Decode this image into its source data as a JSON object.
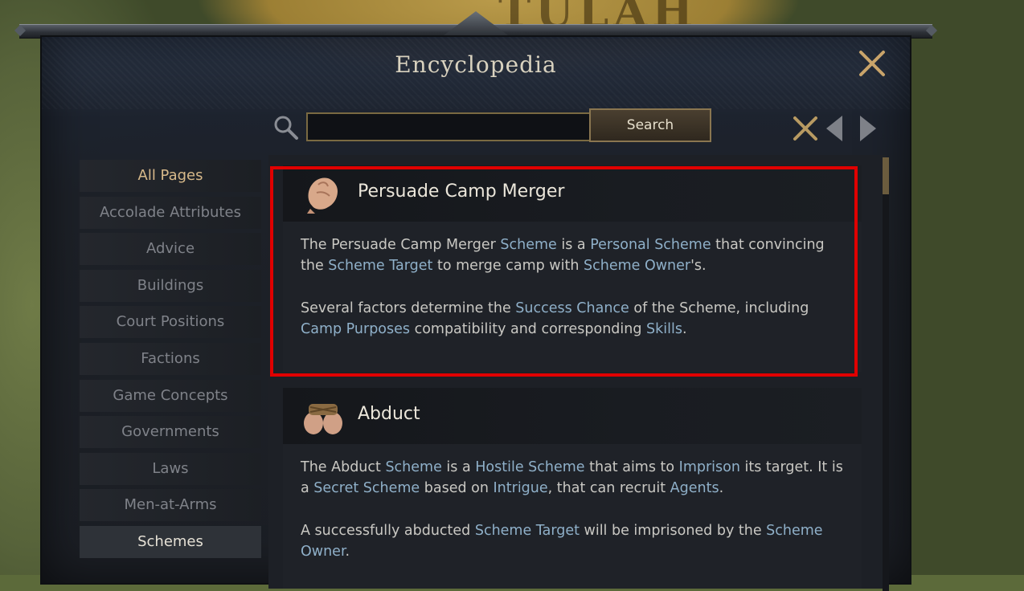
{
  "window": {
    "title": "Encyclopedia"
  },
  "search": {
    "placeholder": "",
    "value": "",
    "button_label": "Search"
  },
  "sidebar": {
    "items": [
      {
        "label": "All Pages"
      },
      {
        "label": "Accolade Attributes"
      },
      {
        "label": "Advice"
      },
      {
        "label": "Buildings"
      },
      {
        "label": "Court Positions"
      },
      {
        "label": "Factions"
      },
      {
        "label": "Game Concepts"
      },
      {
        "label": "Governments"
      },
      {
        "label": "Laws"
      },
      {
        "label": "Men-at-Arms"
      },
      {
        "label": "Schemes"
      }
    ],
    "active": "Schemes"
  },
  "entries": [
    {
      "title": "Persuade Camp Merger",
      "icon": "open-hand-icon",
      "p1": [
        "The Persuade Camp Merger ",
        "Scheme",
        " is a ",
        "Personal Scheme",
        " that convincing the ",
        "Scheme Target",
        " to merge camp with ",
        "Scheme Owner",
        "'s."
      ],
      "p2": [
        "Several factors determine the ",
        "Success Chance",
        " of the Scheme, including ",
        "Camp Purposes",
        " compatibility and corresponding ",
        "Skills",
        "."
      ]
    },
    {
      "title": "Abduct",
      "icon": "bound-hands-icon",
      "p1": [
        "The Abduct ",
        "Scheme",
        " is a ",
        "Hostile Scheme",
        " that aims to ",
        "Imprison",
        " its target. It is a ",
        "Secret Scheme",
        " based on ",
        "Intrigue",
        ", that can recruit ",
        "Agents",
        "."
      ],
      "p2": [
        "A successfully abducted ",
        "Scheme Target",
        " will be imprisoned by the ",
        "Scheme Owner",
        "."
      ]
    }
  ],
  "map": {
    "title": "TULAH"
  },
  "colors": {
    "accent": "#d7b98a",
    "link": "#8fb0c9",
    "highlight": "#e00000",
    "close": "#c9a46a"
  }
}
